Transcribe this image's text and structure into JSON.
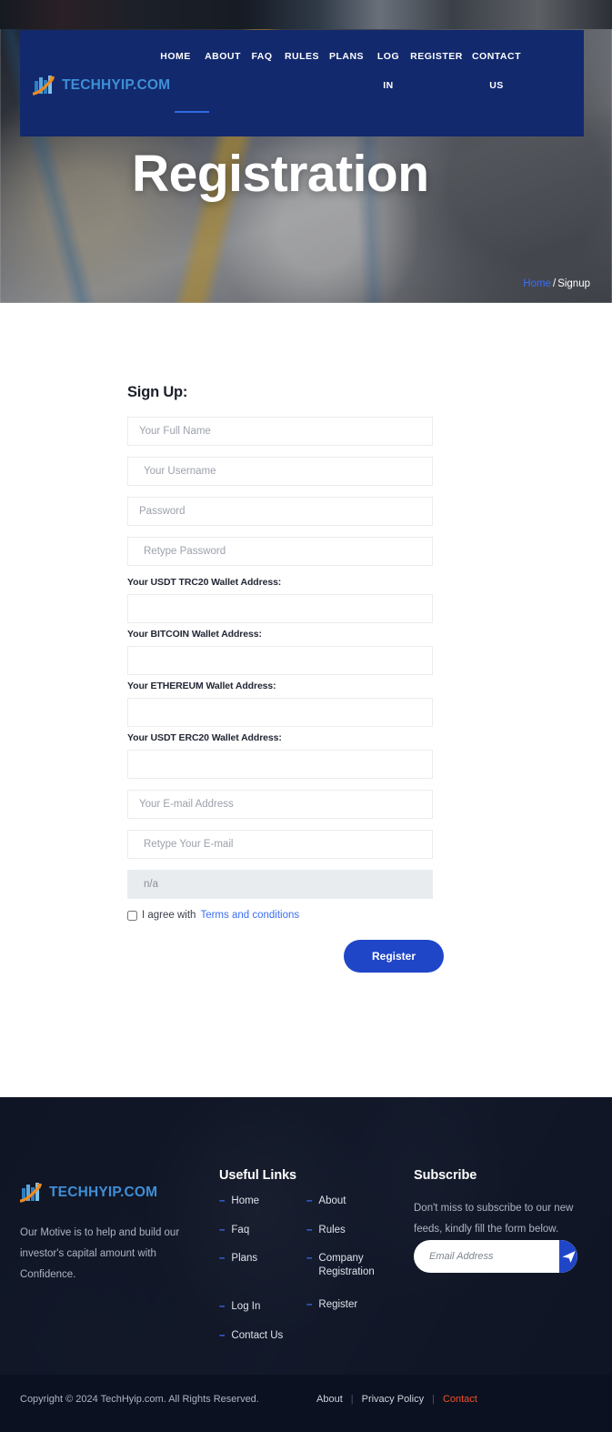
{
  "site": {
    "logo_text": "TECHHYIP.COM",
    "logo_icon": "bar-chart-swoosh-logo"
  },
  "nav": {
    "items": [
      {
        "label": "HOME",
        "second": ""
      },
      {
        "label": "ABOUT",
        "second": ""
      },
      {
        "label": "FAQ",
        "second": ""
      },
      {
        "label": "RULES",
        "second": ""
      },
      {
        "label": "PLANS",
        "second": ""
      },
      {
        "label": "LOG",
        "second": "IN"
      },
      {
        "label": "REGISTER",
        "second": ""
      },
      {
        "label": "CONTACT",
        "second": "US"
      }
    ]
  },
  "hero": {
    "title": "Registration",
    "breadcrumb_home": "Home",
    "breadcrumb_separator": "/",
    "breadcrumb_current": "Signup"
  },
  "form": {
    "title": "Sign Up:",
    "fields": [
      {
        "name": "full-name",
        "placeholder": "Your Full Name",
        "value": "",
        "label": ""
      },
      {
        "name": "username",
        "placeholder": "Your Username",
        "value": "",
        "label": ""
      },
      {
        "name": "password",
        "placeholder": "Password",
        "value": "",
        "label": ""
      },
      {
        "name": "retype-password",
        "placeholder": "Retype Password",
        "value": "",
        "label": ""
      }
    ],
    "wallet_labels": {
      "usdt_trc20": "Your USDT TRC20 Wallet Address:",
      "bitcoin": "Your BITCOIN Wallet Address:",
      "ethereum": "Your ETHEREUM Wallet Address:",
      "usdt_erc20": "Your USDT ERC20 Wallet Address:"
    },
    "email_placeholder": "Your E-mail Address",
    "email_retype_placeholder": "Retype Your E-mail",
    "referral_value": "n/a",
    "agree_prefix": "I agree with",
    "terms_link": "Terms and conditions",
    "submit_label": "Register"
  },
  "footer": {
    "logo_text": "TECHHYIP.COM",
    "description": "Our Motive is to help and build our investor's capital amount with Confidence.",
    "useful_links_heading": "Useful Links",
    "links_col1": [
      "Home",
      "Faq",
      "Plans",
      "Log In",
      "Contact Us"
    ],
    "links_col2": [
      "About",
      "Rules",
      "Company Registration",
      "Register"
    ],
    "subscribe_heading": "Subscribe",
    "subscribe_desc": "Don't miss to subscribe to our new feeds, kindly fill the form below.",
    "subscribe_placeholder": "Email Address",
    "subscribe_icon": "paper-plane-icon",
    "copyright": "Copyright © 2024 TechHyip.com. All Rights Reserved.",
    "bottom_links": [
      {
        "label": "About",
        "accent": false
      },
      {
        "label": "Privacy Policy",
        "accent": false
      },
      {
        "label": "Contact",
        "accent": true
      }
    ],
    "separator": "|"
  },
  "colors": {
    "nav_blue": "#12296e",
    "accent_blue": "#2046c8",
    "link_blue": "#3b6ef5",
    "logo_blue": "#3f8fd6",
    "logo_orange": "#f08a1e",
    "contact_orange": "#f2502a",
    "footer_dark": "#131a2b",
    "footer_bottom": "#0b1120"
  }
}
